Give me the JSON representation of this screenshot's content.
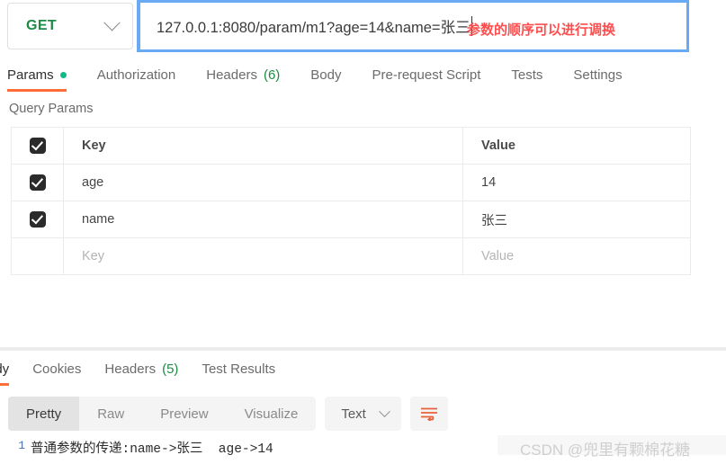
{
  "request": {
    "method": "GET",
    "method_chevron_icon": "chevron-down-icon",
    "url": "127.0.0.1:8080/param/m1?age=14&name=张三",
    "annotation": "参数的顺序可以进行调换"
  },
  "request_tabs": [
    {
      "label": "Params",
      "active": true,
      "dot": true
    },
    {
      "label": "Authorization",
      "active": false
    },
    {
      "label": "Headers",
      "count": "(6)",
      "active": false
    },
    {
      "label": "Body",
      "active": false
    },
    {
      "label": "Pre-request Script",
      "active": false
    },
    {
      "label": "Tests",
      "active": false
    },
    {
      "label": "Settings",
      "active": false
    }
  ],
  "query_params": {
    "title": "Query Params",
    "columns": {
      "key": "Key",
      "value": "Value"
    },
    "rows": [
      {
        "checked": true,
        "key": "age",
        "value": "14"
      },
      {
        "checked": true,
        "key": "name",
        "value": "张三"
      },
      {
        "checked": false,
        "key": "Key",
        "value": "Value",
        "placeholder": true
      }
    ]
  },
  "response_tabs": [
    {
      "label": "ody",
      "active": true
    },
    {
      "label": "Cookies",
      "active": false
    },
    {
      "label": "Headers",
      "count": "(5)",
      "active": false
    },
    {
      "label": "Test Results",
      "active": false
    }
  ],
  "view_toolbar": {
    "modes": [
      {
        "label": "Pretty",
        "active": true
      },
      {
        "label": "Raw",
        "active": false
      },
      {
        "label": "Preview",
        "active": false
      },
      {
        "label": "Visualize",
        "active": false
      }
    ],
    "type": "Text",
    "type_chevron_icon": "chevron-down-icon",
    "wrap_icon": "wrap-text-icon"
  },
  "response_body": {
    "line_number": "1",
    "text": "普通参数的传递:name->张三  age->14"
  },
  "watermark": "CSDN @兜里有颗棉花糖",
  "colors": {
    "accent": "#ff6c37",
    "method_green": "#1d8a45",
    "focus_blue": "#6aa9f4",
    "annotation_red": "#ff4d4d"
  }
}
